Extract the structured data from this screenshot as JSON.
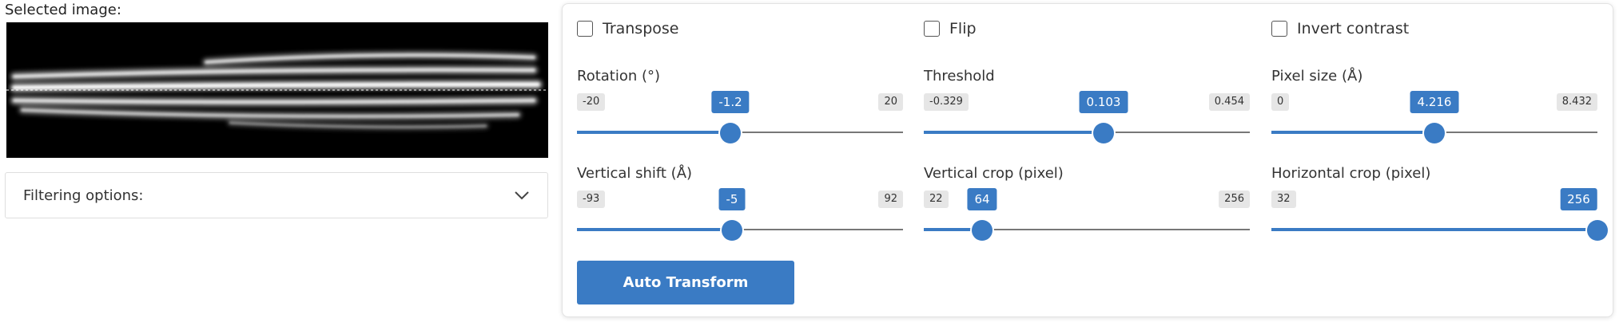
{
  "left": {
    "selected_label": "Selected image:",
    "filter_label": "Filtering options:"
  },
  "checkboxes": [
    {
      "label": "Transpose",
      "checked": false
    },
    {
      "label": "Flip",
      "checked": false
    },
    {
      "label": "Invert contrast",
      "checked": false
    }
  ],
  "sliders": [
    {
      "title": "Rotation (°)",
      "min": "-20",
      "max": "20",
      "value": "-1.2",
      "min_v": -20,
      "max_v": 20,
      "v": -1.2
    },
    {
      "title": "Threshold",
      "min": "-0.329",
      "max": "0.454",
      "value": "0.103",
      "min_v": -0.329,
      "max_v": 0.454,
      "v": 0.103
    },
    {
      "title": "Pixel size (Å)",
      "min": "0",
      "max": "8.432",
      "value": "4.216",
      "min_v": 0,
      "max_v": 8.432,
      "v": 4.216
    },
    {
      "title": "Vertical shift (Å)",
      "min": "-93",
      "max": "92",
      "value": "-5",
      "min_v": -93,
      "max_v": 92,
      "v": -5
    },
    {
      "title": "Vertical crop (pixel)",
      "min": "22",
      "max": "256",
      "value": "64",
      "min_v": 22,
      "max_v": 256,
      "v": 64
    },
    {
      "title": "Horizontal crop (pixel)",
      "min": "32",
      "max": "256",
      "value": "256",
      "min_v": 32,
      "max_v": 256,
      "v": 256
    }
  ],
  "auto_transform_label": "Auto Transform",
  "colors": {
    "accent": "#3a7bc4",
    "badge": "#e6e6e6"
  }
}
